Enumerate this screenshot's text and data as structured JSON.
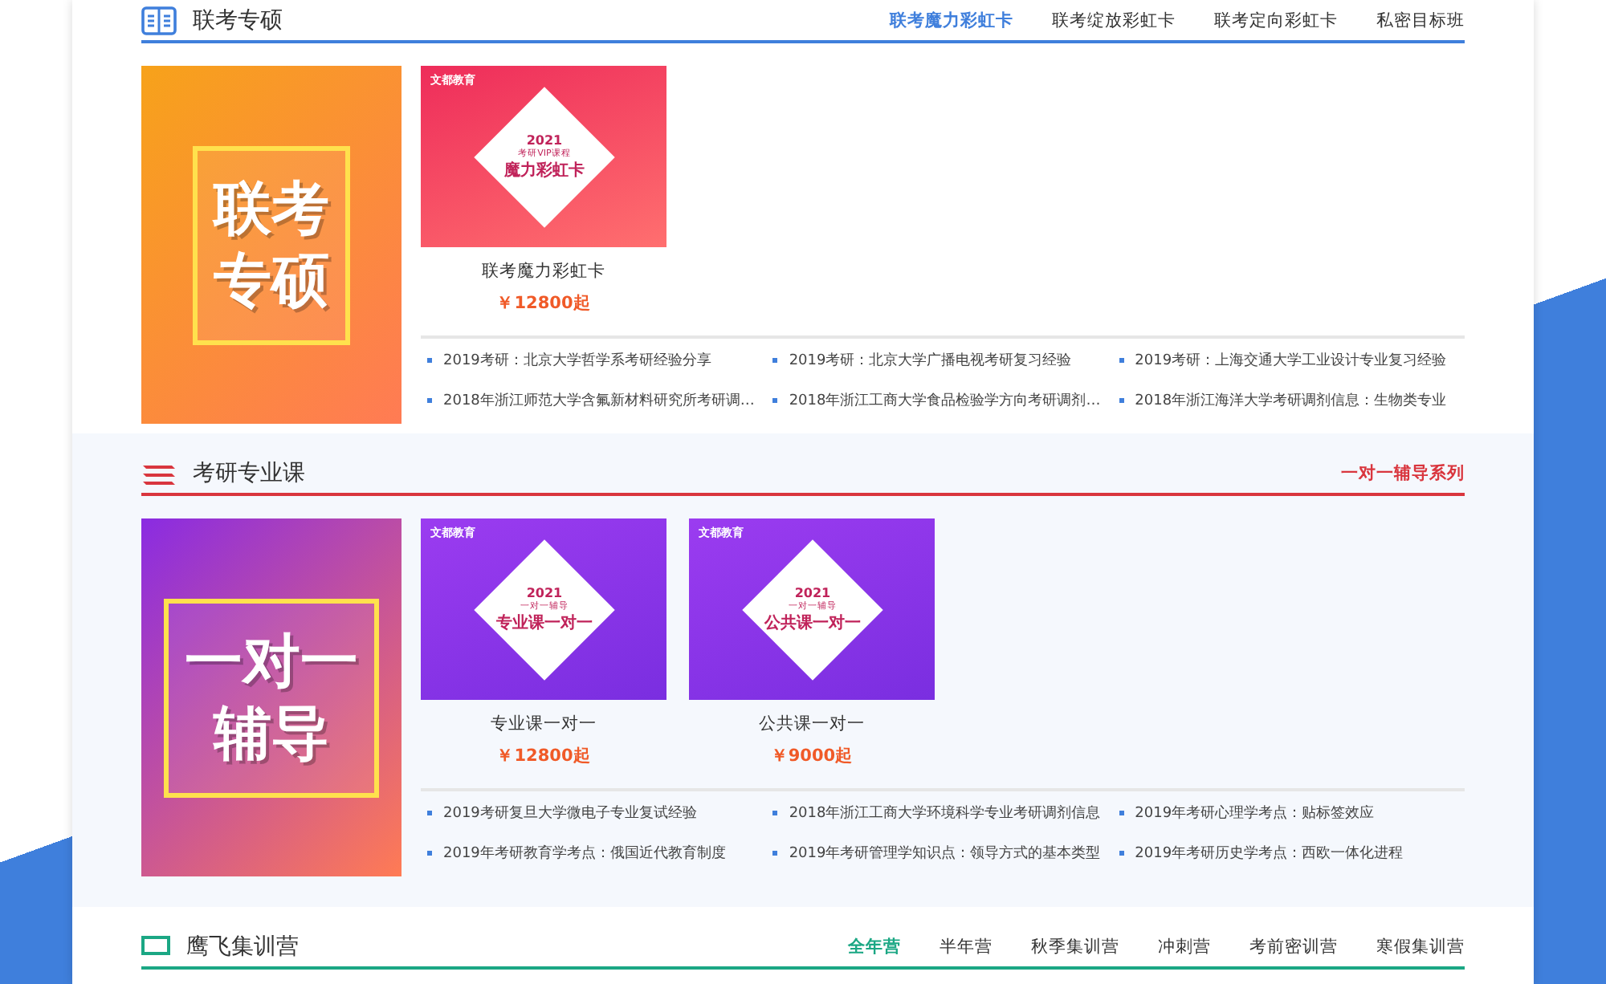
{
  "sections": [
    {
      "kind": "tabs",
      "title": "联考专硕",
      "color": "#3f7fdc",
      "tabs": [
        {
          "label": "联考魔力彩虹卡",
          "selected": true
        },
        {
          "label": "联考绽放彩虹卡",
          "selected": false
        },
        {
          "label": "联考定向彩虹卡",
          "selected": false
        },
        {
          "label": "私密目标班",
          "selected": false
        }
      ],
      "poster": {
        "color": "#f7a21a",
        "lines": [
          "联考",
          "专硕"
        ]
      },
      "products": [
        {
          "name": "联考魔力彩虹卡",
          "price": "￥12800起",
          "image": {
            "color": "#ee2c5a",
            "brand": "文都教育",
            "year": "2021",
            "subtitle": "考研VIP课程",
            "headline": "魔力彩虹卡"
          }
        }
      ],
      "articles": [
        "2019考研：北京大学哲学系考研经验分享",
        "2019考研：北京大学广播电视考研复习经验",
        "2019考研：上海交通大学工业设计专业复习经验",
        "2018年浙江师范大学含氟新材料研究所考研调…",
        "2018年浙江工商大学食品检验学方向考研调剂…",
        "2018年浙江海洋大学考研调剂信息：生物类专业"
      ]
    },
    {
      "kind": "link",
      "title": "考研专业课",
      "color": "#d9363e",
      "link": "一对一辅导系列",
      "poster": {
        "color": "#8a2be2",
        "lines": [
          "一对一",
          "辅导"
        ]
      },
      "products": [
        {
          "name": "专业课一对一",
          "price": "￥12800起",
          "image": {
            "color": "#9b3cf0",
            "brand": "文都教育",
            "year": "2021",
            "subtitle": "一对一辅导",
            "headline": "专业课一对一"
          }
        },
        {
          "name": "公共课一对一",
          "price": "￥9000起",
          "image": {
            "color": "#9b3cf0",
            "brand": "文都教育",
            "year": "2021",
            "subtitle": "一对一辅导",
            "headline": "公共课一对一"
          }
        }
      ],
      "articles": [
        "2019考研复旦大学微电子专业复试经验",
        "2018年浙江工商大学环境科学专业考研调剂信息",
        "2019年考研心理学考点：贴标签效应",
        "2019年考研教育学考点：俄国近代教育制度",
        "2019年考研管理学知识点：领导方式的基本类型",
        "2019年考研历史学考点：西欧一体化进程"
      ]
    },
    {
      "kind": "tabs",
      "title": "鹰飞集训营",
      "color": "#1ba784",
      "tabs": [
        {
          "label": "全年营",
          "selected": true
        },
        {
          "label": "半年营",
          "selected": false
        },
        {
          "label": "秋季集训营",
          "selected": false
        },
        {
          "label": "冲刺营",
          "selected": false
        },
        {
          "label": "考前密训营",
          "selected": false
        },
        {
          "label": "寒假集训营",
          "selected": false
        }
      ]
    }
  ]
}
